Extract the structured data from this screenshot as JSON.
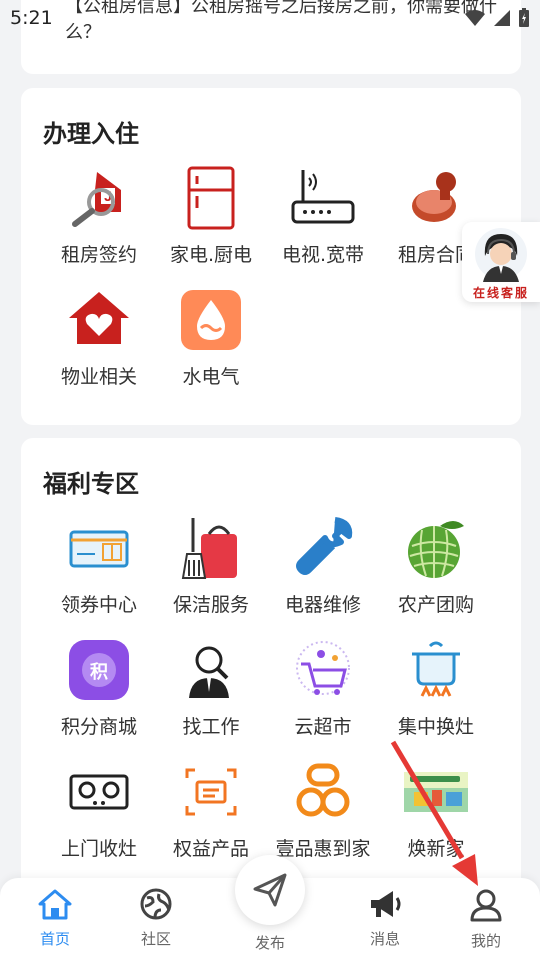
{
  "status_bar": {
    "time": "5:21"
  },
  "news": {
    "text": "【公租房信息】公租房摇号之后接房之前，你需要做什么？"
  },
  "checkin": {
    "title": "办理入住",
    "items": [
      {
        "label": "租房签约",
        "icon": "house-search-icon"
      },
      {
        "label": "家电.厨电",
        "icon": "fridge-icon"
      },
      {
        "label": "电视.宽带",
        "icon": "router-icon"
      },
      {
        "label": "租房合同",
        "icon": "stamp-icon"
      },
      {
        "label": "物业相关",
        "icon": "heart-house-icon"
      },
      {
        "label": "水电气",
        "icon": "water-drop-icon"
      }
    ]
  },
  "welfare": {
    "title": "福利专区",
    "items": [
      {
        "label": "领券中心",
        "icon": "coupon-icon"
      },
      {
        "label": "保洁服务",
        "icon": "cleaning-icon"
      },
      {
        "label": "电器维修",
        "icon": "wrench-icon"
      },
      {
        "label": "农产团购",
        "icon": "melon-icon"
      },
      {
        "label": "积分商城",
        "icon": "points-icon"
      },
      {
        "label": "找工作",
        "icon": "job-icon"
      },
      {
        "label": "云超市",
        "icon": "cart-icon"
      },
      {
        "label": "集中换灶",
        "icon": "stove-pot-icon"
      },
      {
        "label": "上门收灶",
        "icon": "gas-stove-icon"
      },
      {
        "label": "权益产品",
        "icon": "benefits-icon"
      },
      {
        "label": "壹品惠到家",
        "icon": "yipin-logo-icon"
      },
      {
        "label": "焕新家",
        "icon": "renew-home-icon"
      }
    ]
  },
  "customer_service": {
    "label": "在线客服"
  },
  "tabbar": {
    "tabs": [
      {
        "label": "首页",
        "icon": "home-icon",
        "active": true
      },
      {
        "label": "社区",
        "icon": "community-icon",
        "active": false
      },
      {
        "label": "发布",
        "icon": "send-icon",
        "active": false
      },
      {
        "label": "消息",
        "icon": "megaphone-icon",
        "active": false
      },
      {
        "label": "我的",
        "icon": "user-icon",
        "active": false
      }
    ]
  },
  "colors": {
    "accent": "#2d8cf0",
    "primary_red": "#c8211e",
    "annotation_red": "#e53935",
    "background": "#f2f3f5"
  }
}
